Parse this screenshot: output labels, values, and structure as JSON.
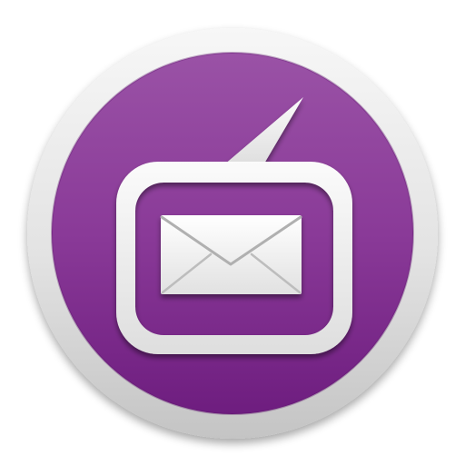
{
  "icon": {
    "name": "mail-chat-app-icon",
    "glyph": "envelope-in-speech-bubble",
    "colors": {
      "badge_fill_top": "#9a52a6",
      "badge_fill_bottom": "#6e1d7f",
      "rim_light": "#f6f6f6",
      "rim_dark": "#c8c8c8",
      "glyph": "#f2f2f2"
    }
  }
}
